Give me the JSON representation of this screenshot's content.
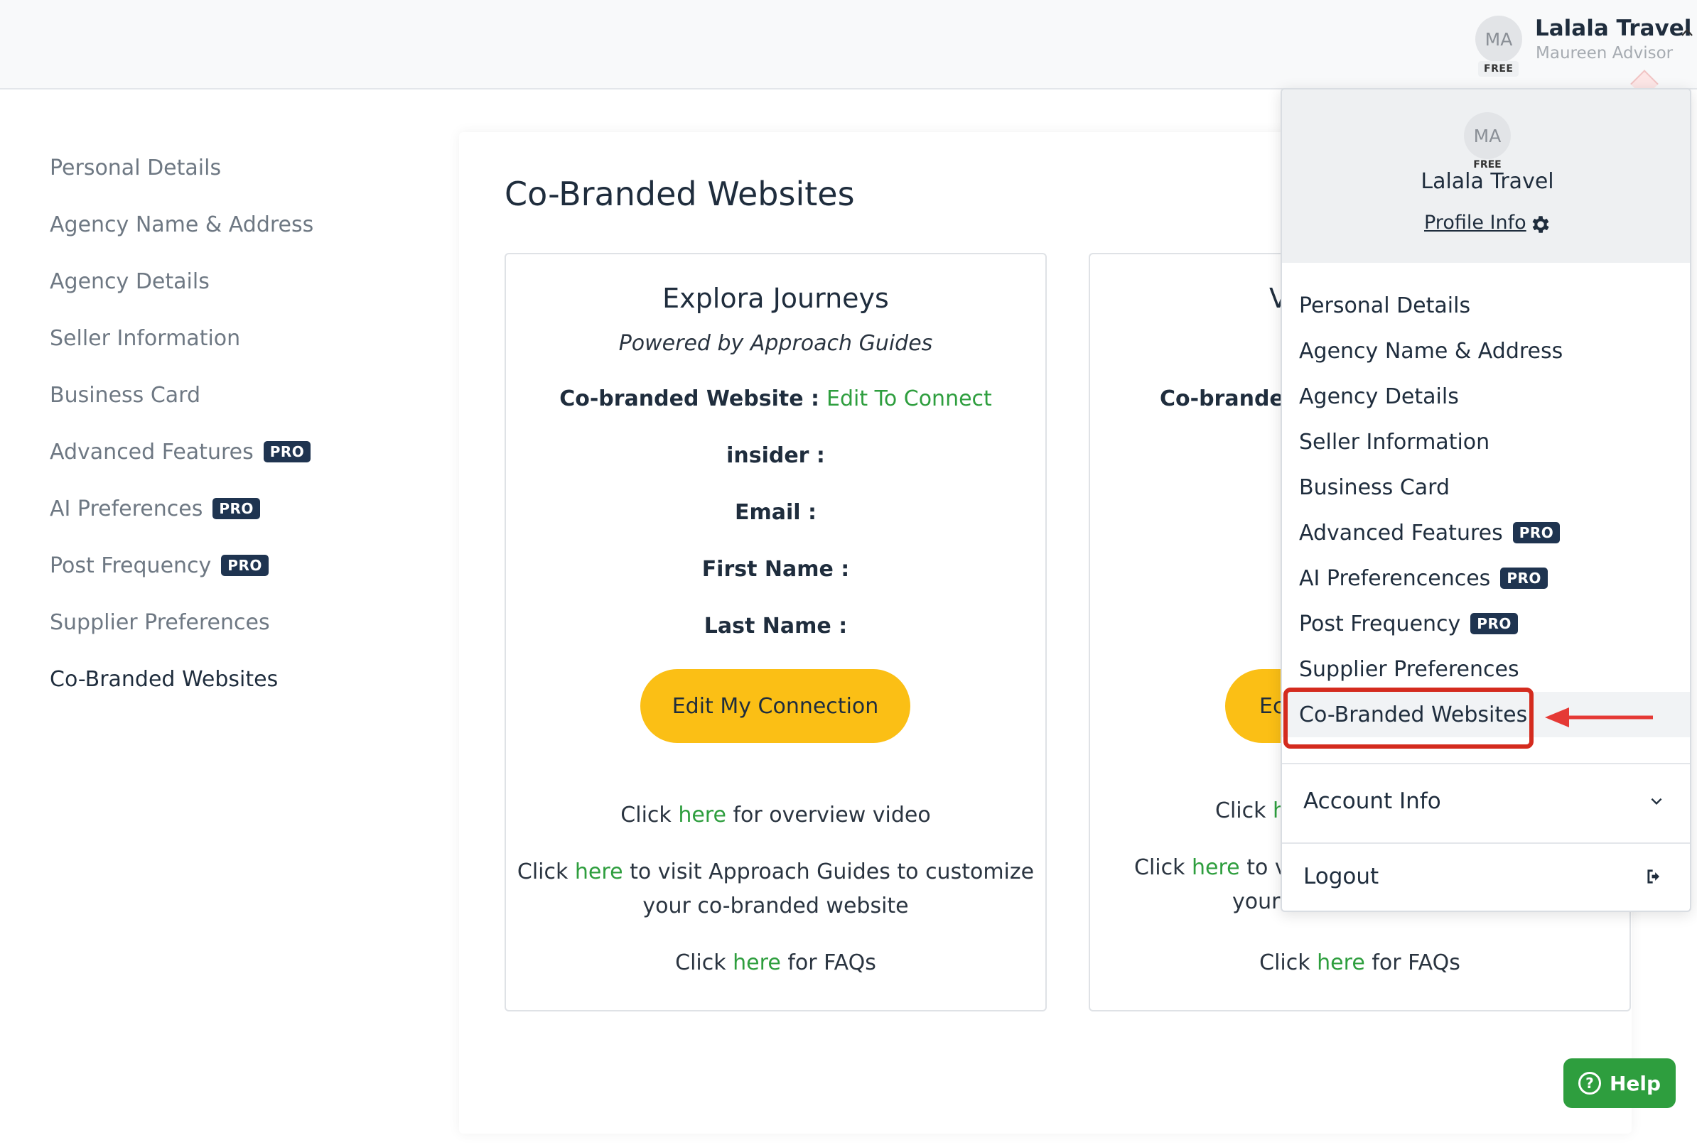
{
  "header": {
    "avatar_initials": "MA",
    "plan_badge": "FREE",
    "agency_name": "Lalala Travel",
    "user_name": "Maureen Advisor"
  },
  "left_nav": {
    "items": [
      {
        "label": "Personal Details",
        "badge": ""
      },
      {
        "label": "Agency Name & Address",
        "badge": ""
      },
      {
        "label": "Agency Details",
        "badge": ""
      },
      {
        "label": "Seller Information",
        "badge": ""
      },
      {
        "label": "Business Card",
        "badge": ""
      },
      {
        "label": "Advanced Features",
        "badge": "PRO"
      },
      {
        "label": "AI Preferences",
        "badge": "PRO"
      },
      {
        "label": "Post Frequency",
        "badge": "PRO"
      },
      {
        "label": "Supplier Preferences",
        "badge": ""
      },
      {
        "label": "Co-Branded Websites",
        "badge": ""
      }
    ]
  },
  "main": {
    "title": "Co-Branded Websites",
    "card1": {
      "title": "Explora Journeys",
      "subtitle": "Powered by Approach Guides",
      "website_label": "Co-branded Website :",
      "website_link": "Edit To Connect",
      "insider_label": "insider :",
      "email_label": "Email :",
      "first_name_label": "First Name :",
      "last_name_label": "Last Name :",
      "button": "Edit My Connection",
      "click": "Click",
      "here": "here",
      "video_suffix": "for overview video",
      "visit_suffix": "to visit Approach Guides to customize",
      "visit_line2": "your co-branded website",
      "faq_suffix": "for FAQs"
    },
    "card2": {
      "title_partial": "V",
      "website_partial": "Co-brande",
      "button_partial": "Ec",
      "click_partial": "Click",
      "here_partial": "h",
      "visit_click": "Click",
      "visit_here": "here",
      "visit_partial": "to vi",
      "visit_line2_partial": "your",
      "faq_click": "Click",
      "faq_here": "here",
      "faq_suffix": "for FAQs"
    }
  },
  "dropdown": {
    "avatar_initials": "MA",
    "plan_badge": "FREE",
    "agency_name": "Lalala Travel",
    "profile_link": "Profile Info",
    "items": [
      {
        "label": "Personal Details",
        "badge": ""
      },
      {
        "label": "Agency Name & Address",
        "badge": ""
      },
      {
        "label": "Agency Details",
        "badge": ""
      },
      {
        "label": "Seller Information",
        "badge": ""
      },
      {
        "label": "Business Card",
        "badge": ""
      },
      {
        "label": "Advanced Features",
        "badge": "PRO"
      },
      {
        "label": "AI Preferencences",
        "badge": "PRO"
      },
      {
        "label": "Post Frequency",
        "badge": "PRO"
      },
      {
        "label": "Supplier Preferences",
        "badge": ""
      },
      {
        "label": "Co-Branded Websites",
        "badge": ""
      }
    ],
    "account_info": "Account Info",
    "logout": "Logout"
  },
  "help_button": "Help",
  "colors": {
    "accent_green": "#2e9e3e",
    "button_yellow": "#fbbf15",
    "pro_badge": "#1f3450",
    "annotation_red": "#d42b1e"
  },
  "icons": [
    "chevron-up-icon",
    "gear-icon",
    "chevron-down-icon",
    "logout-icon",
    "question-circle-icon",
    "arrow-left-icon"
  ]
}
